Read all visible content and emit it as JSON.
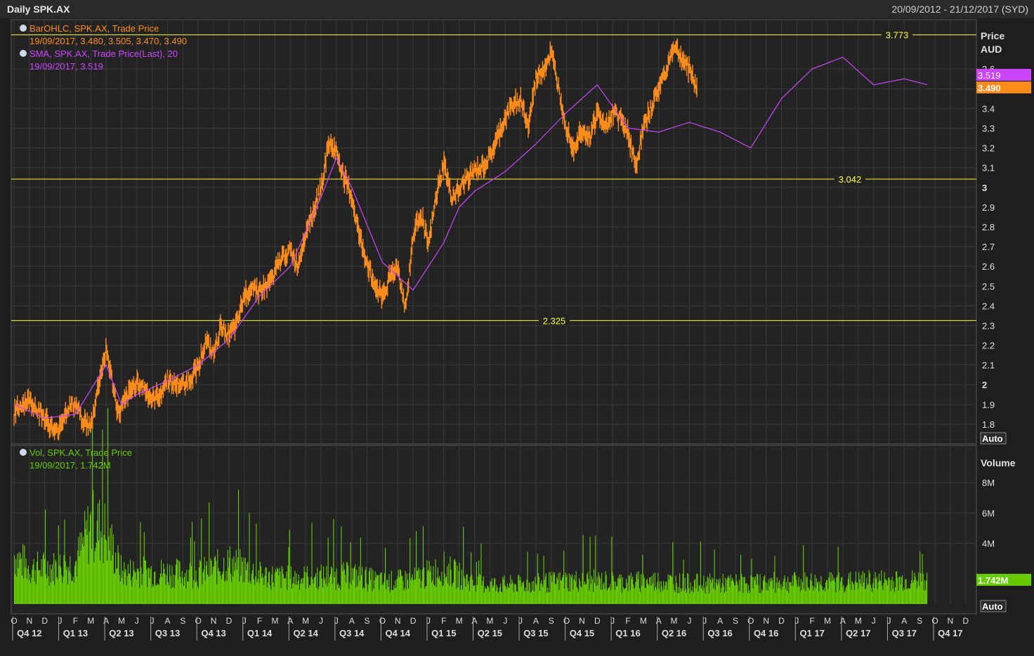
{
  "window": {
    "title": "Daily SPK.AX",
    "date_range": "20/09/2012 - 21/12/2017 (SYD)"
  },
  "legend": {
    "ohlc_name": "BarOHLC, SPK.AX, Trade Price",
    "ohlc_values": "19/09/2017, 3.480, 3.505, 3.470, 3.490",
    "sma_name": "SMA, SPK.AX, Trade Price(Last),  20",
    "sma_values": "19/09/2017, 3.519",
    "vol_name": "Vol, SPK.AX, Trade Price",
    "vol_values": "19/09/2017, 1.742M"
  },
  "price_axis": {
    "title": "Price",
    "unit": "AUD",
    "auto_label": "Auto"
  },
  "volume_axis": {
    "title": "Volume",
    "auto_label": "Auto"
  },
  "current": {
    "sma": "3.519",
    "last": "3.490",
    "volume": "1.742M"
  },
  "colors": {
    "price": "#ff8c1a",
    "sma": "#cc44ff",
    "volume": "#66cc00",
    "hlines": "#ffff33",
    "grid": "#3a3a3a"
  },
  "chart_data": {
    "type": "line",
    "price_ylim": [
      1.7,
      3.85
    ],
    "price_ticks": [
      "1.8",
      "1.9",
      "2",
      "2.1",
      "2.2",
      "2.3",
      "2.4",
      "2.5",
      "2.6",
      "2.7",
      "2.8",
      "2.9",
      "3",
      "3.1",
      "3.2",
      "3.3",
      "3.4",
      "3.5",
      "3.6"
    ],
    "volume_ylim": [
      0,
      10
    ],
    "volume_ticks": [
      "4M",
      "6M",
      "8M"
    ],
    "horizontal_lines": [
      {
        "value": 3.773,
        "label": "3.773"
      },
      {
        "value": 3.042,
        "label": "3.042"
      },
      {
        "value": 2.325,
        "label": "2.325"
      }
    ],
    "month_labels": [
      "O",
      "N",
      "D",
      "J",
      "F",
      "M",
      "A",
      "M",
      "J",
      "J",
      "A",
      "S",
      "O",
      "N",
      "D",
      "J",
      "F",
      "M",
      "A",
      "M",
      "J",
      "J",
      "A",
      "S",
      "O",
      "N",
      "D",
      "J",
      "F",
      "M",
      "A",
      "M",
      "J",
      "J",
      "A",
      "S",
      "O",
      "N",
      "D",
      "J",
      "F",
      "M",
      "A",
      "M",
      "J",
      "J",
      "A",
      "S",
      "O",
      "N",
      "D",
      "J",
      "F",
      "M",
      "A",
      "M",
      "J",
      "J",
      "A",
      "S",
      "O",
      "N",
      "D"
    ],
    "quarter_labels": [
      "Q4 12",
      "Q1 13",
      "Q2 13",
      "Q3 13",
      "Q4 13",
      "Q1 14",
      "Q2 14",
      "Q3 14",
      "Q4 14",
      "Q1 15",
      "Q2 15",
      "Q3 15",
      "Q4 15",
      "Q1 16",
      "Q2 16",
      "Q3 16",
      "Q4 16",
      "Q1 17",
      "Q2 17",
      "Q3 17",
      "Q4 17"
    ],
    "price_series": {
      "name": "SPK.AX",
      "x_month": [
        0,
        0.5,
        1,
        1.5,
        2,
        2.7,
        3,
        3.5,
        4,
        4.5,
        5,
        5.5,
        6,
        6.8,
        7,
        7.5,
        8,
        8.5,
        9,
        9.5,
        10,
        10.5,
        11,
        11.5,
        12,
        12.5,
        13,
        13.5,
        14,
        14.5,
        15,
        15.5,
        16,
        16.5,
        17,
        17.5,
        18,
        18.5,
        19,
        19.5,
        20,
        20.5,
        21,
        21.5,
        22,
        22.5,
        23,
        23.5,
        24,
        24.5,
        25,
        25.5,
        26,
        26.5,
        27,
        27.5,
        28,
        28.5,
        29,
        29.5,
        30,
        30.5,
        31,
        31.5,
        32,
        32.5,
        33,
        33.5,
        34,
        34.5,
        35,
        35.5,
        36,
        36.5,
        37,
        37.5,
        38,
        38.5,
        39,
        39.5,
        40,
        40.5,
        41,
        41.5,
        42,
        42.5,
        43,
        43.5,
        44,
        44.5,
        45,
        45.5,
        46,
        46.5,
        47,
        47.5,
        48,
        48.5,
        49,
        49.5,
        50,
        50.5,
        51,
        51.5,
        52,
        52.5,
        53,
        53.5,
        54,
        54.5,
        55,
        55.5,
        56,
        56.5,
        57,
        57.5,
        58,
        58.5,
        59,
        59.5
      ],
      "y": [
        1.85,
        1.9,
        1.92,
        1.88,
        1.83,
        1.75,
        1.8,
        1.88,
        1.9,
        1.82,
        1.78,
        2.0,
        2.18,
        1.85,
        1.88,
        1.95,
        2.02,
        1.98,
        1.92,
        1.95,
        2.03,
        2.0,
        2.0,
        2.03,
        2.1,
        2.22,
        2.15,
        2.3,
        2.25,
        2.3,
        2.45,
        2.5,
        2.48,
        2.5,
        2.57,
        2.65,
        2.68,
        2.6,
        2.78,
        2.88,
        3.0,
        3.22,
        3.18,
        3.05,
        2.95,
        2.75,
        2.62,
        2.5,
        2.45,
        2.55,
        2.6,
        2.38,
        2.75,
        2.88,
        2.7,
        2.95,
        3.12,
        2.95,
        2.98,
        3.05,
        3.08,
        3.1,
        3.15,
        3.25,
        3.35,
        3.42,
        3.45,
        3.3,
        3.55,
        3.6,
        3.68,
        3.5,
        3.3,
        3.2,
        3.3,
        3.25,
        3.38,
        3.3,
        3.38,
        3.35,
        3.28,
        3.1,
        3.3,
        3.4,
        3.5,
        3.6,
        3.72,
        3.65,
        3.6,
        3.5
      ]
    },
    "sma_series": {
      "name": "SMA 20",
      "x_month": [
        0,
        2,
        4,
        6,
        7,
        8,
        10,
        12,
        14,
        16,
        18,
        20,
        21,
        22,
        24,
        26,
        28,
        29,
        30,
        32,
        34,
        36,
        38,
        40,
        42,
        44,
        46,
        48,
        50,
        52,
        54,
        56,
        58,
        59.5
      ],
      "y": [
        1.9,
        1.83,
        1.85,
        2.1,
        1.9,
        1.95,
        2.02,
        2.1,
        2.23,
        2.45,
        2.6,
        2.95,
        3.15,
        3.0,
        2.62,
        2.48,
        2.72,
        2.9,
        2.98,
        3.08,
        3.22,
        3.38,
        3.52,
        3.3,
        3.28,
        3.33,
        3.28,
        3.2,
        3.45,
        3.6,
        3.66,
        3.52,
        3.55,
        3.52
      ]
    },
    "volume_series": {
      "name": "Vol",
      "x_month": [
        0,
        1,
        3,
        4,
        5,
        6,
        7,
        8,
        10,
        12,
        14,
        15,
        16,
        18,
        20,
        22,
        24,
        26,
        28,
        30,
        32,
        34,
        36,
        38,
        40,
        42,
        44,
        46,
        48,
        50,
        52,
        54,
        56,
        58,
        59.5
      ],
      "y": [
        3.6,
        2.6,
        2.7,
        3.0,
        5.8,
        5.2,
        2.3,
        2.4,
        2.3,
        2.2,
        3.0,
        2.6,
        2.1,
        1.9,
        2.0,
        2.1,
        1.6,
        1.8,
        2.6,
        1.5,
        1.4,
        1.5,
        1.7,
        1.7,
        1.6,
        1.7,
        1.5,
        1.5,
        1.5,
        1.6,
        1.6,
        1.6,
        1.7,
        1.7,
        1.74
      ]
    }
  }
}
